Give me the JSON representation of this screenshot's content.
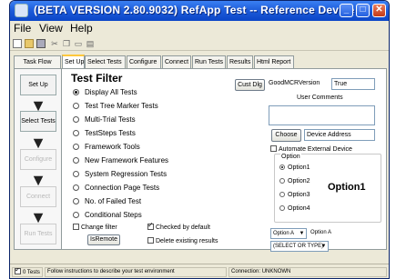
{
  "window": {
    "title": "(BETA VERSION 2.80.9032) RefApp Test -- Reference Device 1"
  },
  "menu": [
    "File",
    "View",
    "Help"
  ],
  "tabs": [
    "Set Up",
    "Select Tests",
    "Configure",
    "Connect",
    "Run Tests",
    "Results",
    "Html Report"
  ],
  "task_flow": {
    "label": "Task Flow",
    "steps": [
      "Set Up",
      "Select Tests",
      "Configure",
      "Connect",
      "Run Tests"
    ]
  },
  "test_filter": {
    "title": "Test Filter",
    "options": [
      {
        "label": "Display All Tests",
        "selected": true
      },
      {
        "label": "Test Tree Marker Tests",
        "selected": false
      },
      {
        "label": "Multi-Trial Tests",
        "selected": false
      },
      {
        "label": "TestSteps Tests",
        "selected": false
      },
      {
        "label": "Framework Tools",
        "selected": false
      },
      {
        "label": "New Framework Features",
        "selected": false
      },
      {
        "label": "System Regression Tests",
        "selected": false
      },
      {
        "label": "Connection Page Tests",
        "selected": false
      },
      {
        "label": "No. of Failed Test",
        "selected": false
      },
      {
        "label": "Conditional Steps",
        "selected": false
      }
    ],
    "change_filter_label": "Change filter",
    "checked_default_label": "Checked by default",
    "is_remote_label": "IsRemote",
    "delete_results_label": "Delete existing results"
  },
  "right": {
    "cust_dlg": "Cust Dlg",
    "good_mcr_label": "GoodMCRVersion",
    "good_mcr_value": "True",
    "user_comments_label": "User Comments",
    "choose_label": "Choose",
    "device_address_value": "Device Address",
    "automate_label": "Automate External Device",
    "option_group_label": "Option",
    "options": [
      "Option1",
      "Option2",
      "Option3",
      "Option4"
    ],
    "selected_option_big": "Option1",
    "select_a_value": "Option A",
    "select_a_label": "Option A",
    "select_type_value": "(SELECT OR TYPE)"
  },
  "status": {
    "tests": "0 Tests",
    "message": "Follow instructions to describe your test environment",
    "connection": "Connection: UNKNOWN"
  }
}
